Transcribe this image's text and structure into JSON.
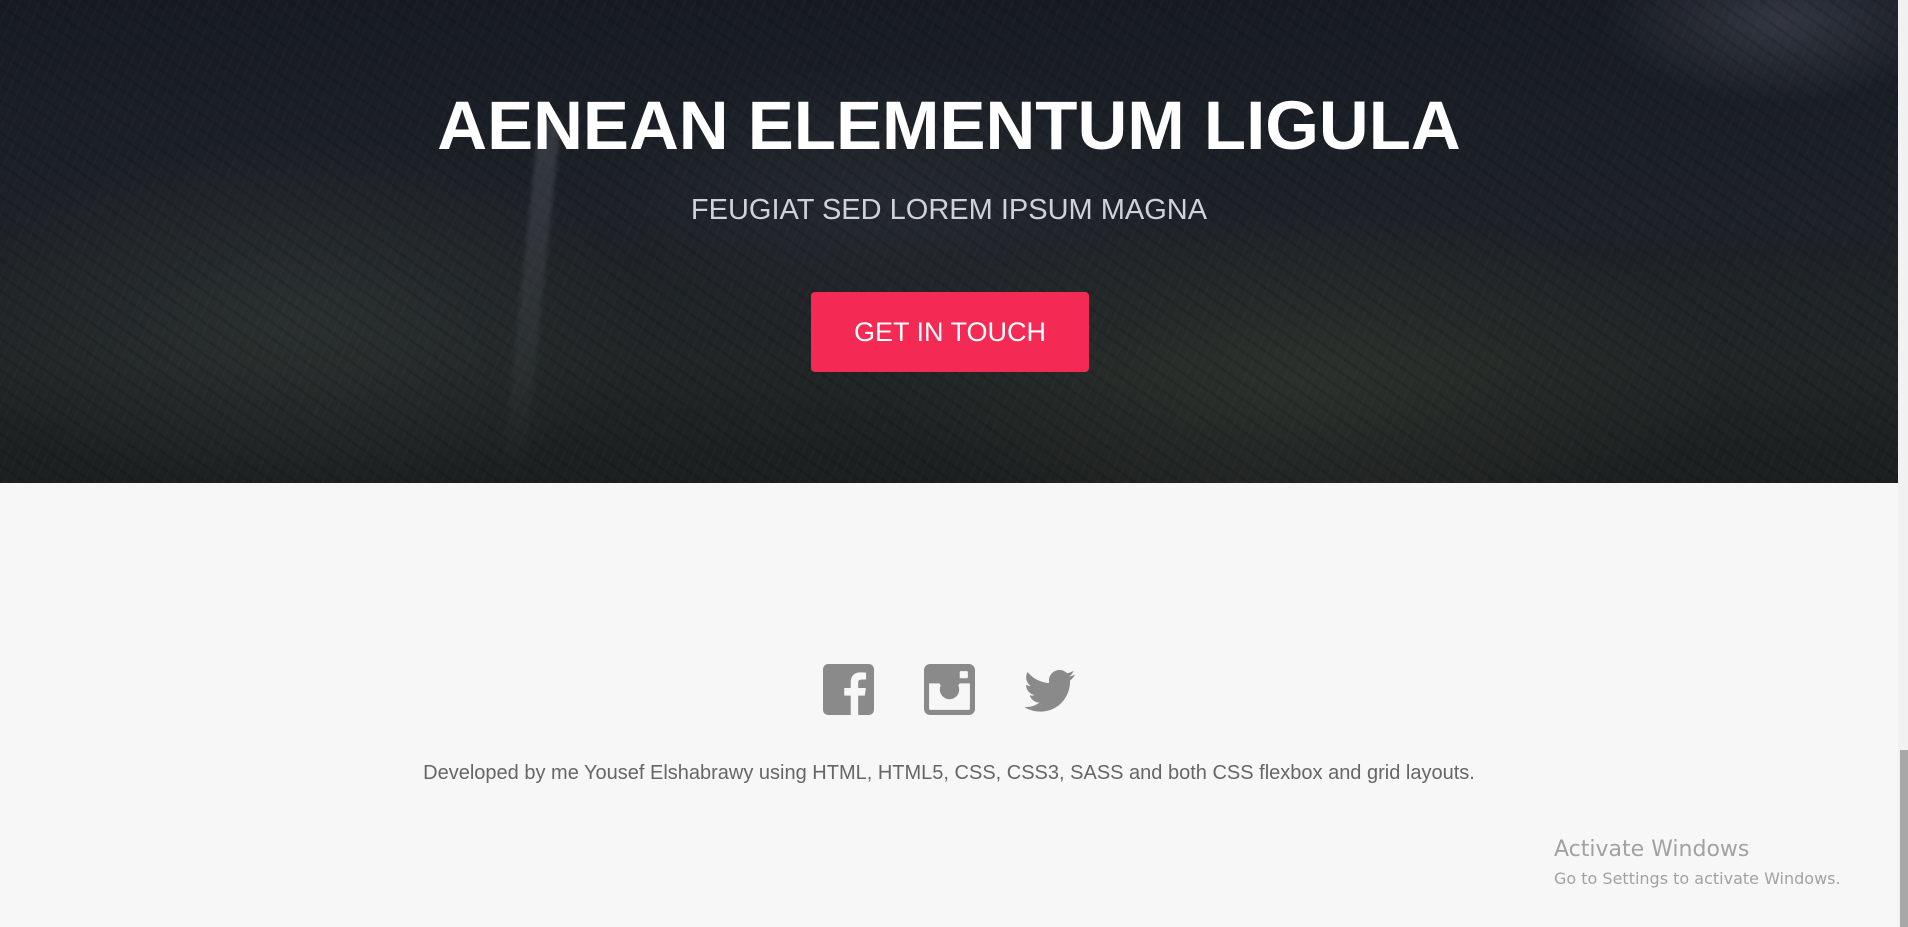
{
  "hero": {
    "title": "AENEAN ELEMENTUM LIGULA",
    "subtitle": "FEUGIAT SED LOREM IPSUM MAGNA",
    "cta_label": "GET IN TOUCH"
  },
  "footer": {
    "social": [
      {
        "icon": "facebook-icon"
      },
      {
        "icon": "instagram-icon"
      },
      {
        "icon": "twitter-icon"
      }
    ],
    "credit": "Developed by me Yousef Elshabrawy using HTML, HTML5, CSS, CSS3, SASS and both CSS flexbox and grid layouts."
  },
  "watermark": {
    "title": "Activate Windows",
    "subtitle": "Go to Settings to activate Windows."
  },
  "colors": {
    "accent": "#f52a54",
    "icon": "#8a8a8a",
    "footer_bg": "#f7f7f7"
  }
}
